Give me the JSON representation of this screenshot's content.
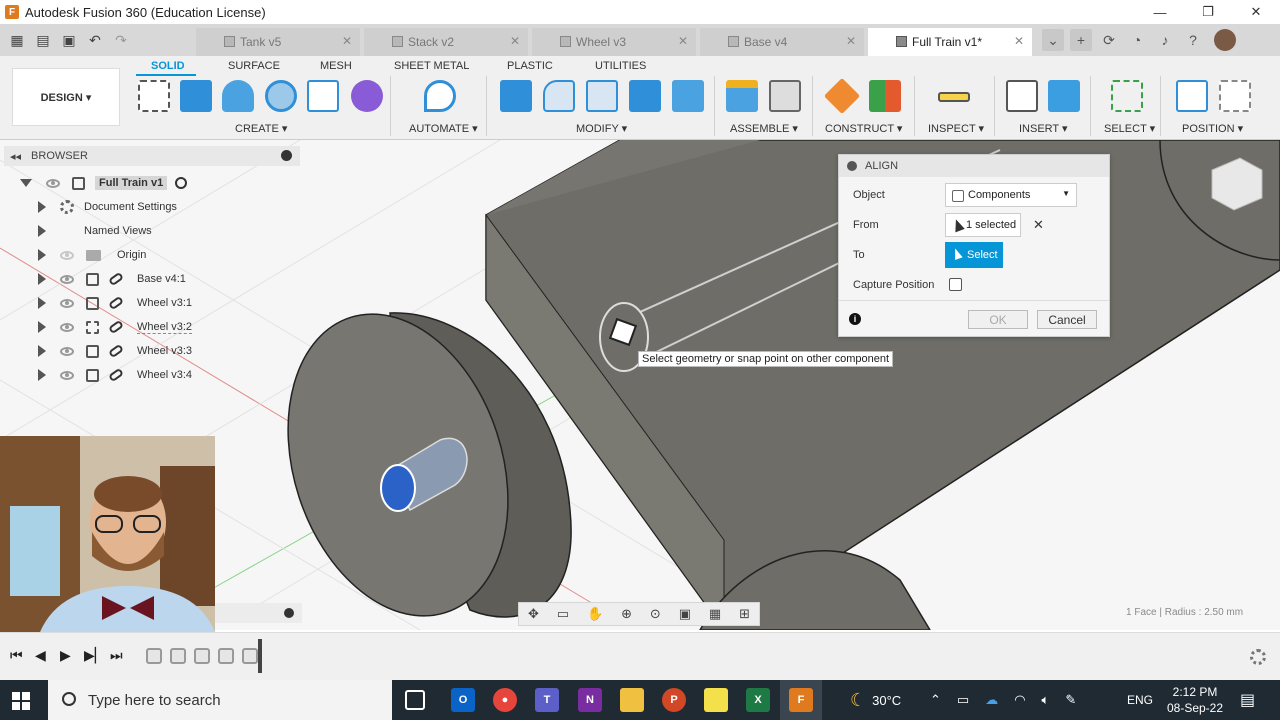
{
  "window": {
    "title": "Autodesk Fusion 360 (Education License)",
    "controls": [
      "—",
      "❐",
      "✕"
    ]
  },
  "tabs": [
    {
      "label": "Tank v5",
      "active": false
    },
    {
      "label": "Stack v2",
      "active": false
    },
    {
      "label": "Wheel v3",
      "active": false
    },
    {
      "label": "Base v4",
      "active": false
    },
    {
      "label": "Full Train v1*",
      "active": true
    }
  ],
  "ribbon": {
    "workspace": "DESIGN ▾",
    "tabs": [
      "SOLID",
      "SURFACE",
      "MESH",
      "SHEET METAL",
      "PLASTIC",
      "UTILITIES"
    ],
    "active_tab": "SOLID",
    "groups": [
      "CREATE ▾",
      "AUTOMATE ▾",
      "MODIFY ▾",
      "ASSEMBLE ▾",
      "CONSTRUCT ▾",
      "INSPECT ▾",
      "INSERT ▾",
      "SELECT ▾",
      "POSITION ▾"
    ]
  },
  "browser": {
    "title": "BROWSER",
    "root": "Full Train v1",
    "items": [
      {
        "label": "Document Settings",
        "icon": "gear-icon"
      },
      {
        "label": "Named Views",
        "icon": "none"
      },
      {
        "label": "Origin",
        "icon": "folder-icon"
      },
      {
        "label": "Base v4:1",
        "icon": "component-icon"
      },
      {
        "label": "Wheel v3:1",
        "icon": "component-icon"
      },
      {
        "label": "Wheel v3:2",
        "icon": "component-icon"
      },
      {
        "label": "Wheel v3:3",
        "icon": "component-icon"
      },
      {
        "label": "Wheel v3:4",
        "icon": "component-icon"
      }
    ]
  },
  "align_dialog": {
    "title": "ALIGN",
    "object_label": "Object",
    "object_value": "Components",
    "from_label": "From",
    "from_value": "1 selected",
    "to_label": "To",
    "to_button": "Select",
    "capture_label": "Capture Position",
    "capture_checked": false,
    "ok": "OK",
    "cancel": "Cancel"
  },
  "tooltip": "Select geometry or snap point on other component",
  "status": "1 Face | Radius : 2.50 mm",
  "taskbar": {
    "search_placeholder": "Type here to search",
    "weather": "30°C",
    "language": "ENG",
    "time": "2:12 PM",
    "date": "08-Sep-22"
  },
  "colors": {
    "accent": "#0696d7",
    "model_gray": "#6e6d67",
    "taskbar": "#1f2a33"
  }
}
